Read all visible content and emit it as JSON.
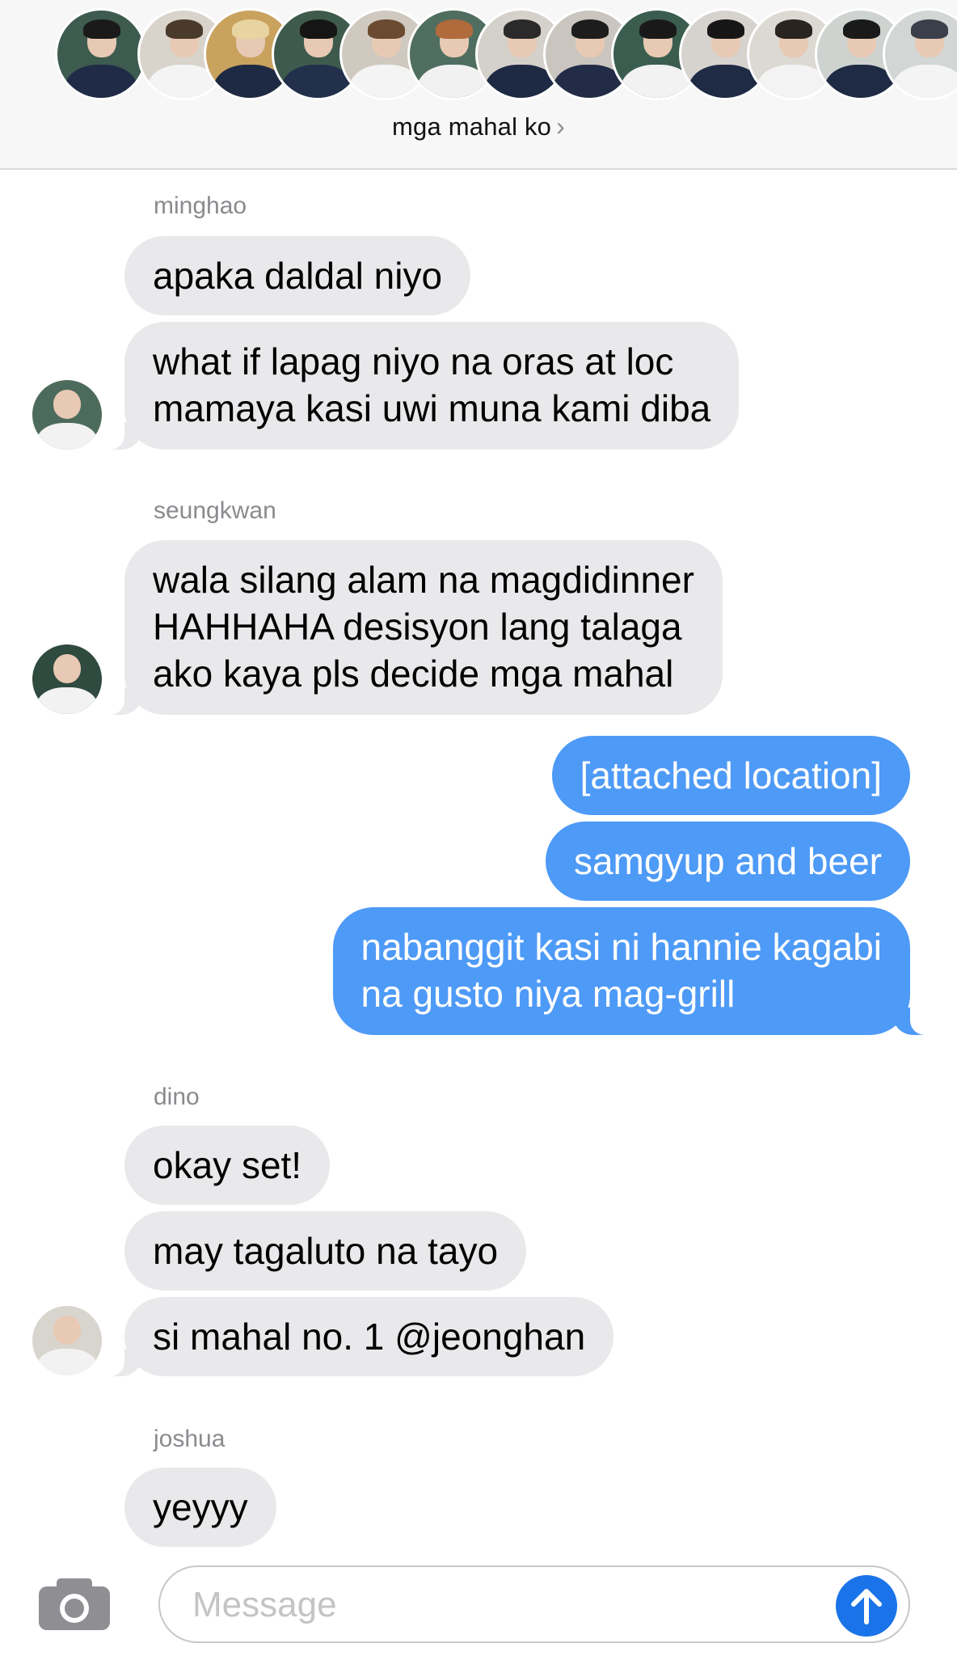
{
  "header": {
    "group_name": "mga mahal ko",
    "chevron": "›",
    "member_avatar_count": 13
  },
  "messages": [
    {
      "type": "sender",
      "text": "minghao"
    },
    {
      "type": "in",
      "text": "apaka daldal niyo"
    },
    {
      "type": "in",
      "text": "what if lapag niyo na oras at loc\nmamaya kasi uwi muna kami diba"
    },
    {
      "type": "sender",
      "text": "seungkwan"
    },
    {
      "type": "in",
      "text": "wala silang alam na magdidinner\nHAHHAHA desisyon lang talaga\nako kaya pls decide mga mahal"
    },
    {
      "type": "out",
      "text": "[attached location]"
    },
    {
      "type": "out",
      "text": "samgyup and beer"
    },
    {
      "type": "out",
      "text": "nabanggit kasi ni hannie kagabi\nna gusto niya mag-grill"
    },
    {
      "type": "sender",
      "text": "dino"
    },
    {
      "type": "in",
      "text": "okay set!"
    },
    {
      "type": "in",
      "text": "may tagaluto na tayo"
    },
    {
      "type": "in",
      "text": "si mahal no. 1 @jeonghan"
    },
    {
      "type": "sender",
      "text": "joshua"
    },
    {
      "type": "in",
      "text": "yeyyy"
    }
  ],
  "input": {
    "placeholder": "Message",
    "camera_icon": "camera-icon",
    "send_icon": "arrow-up-icon"
  },
  "colors": {
    "incoming_bubble": "#e9e9eb",
    "outgoing_bubble": "#4e9af7",
    "send_button": "#1a73e8",
    "sender_label": "#8a8a8f"
  }
}
